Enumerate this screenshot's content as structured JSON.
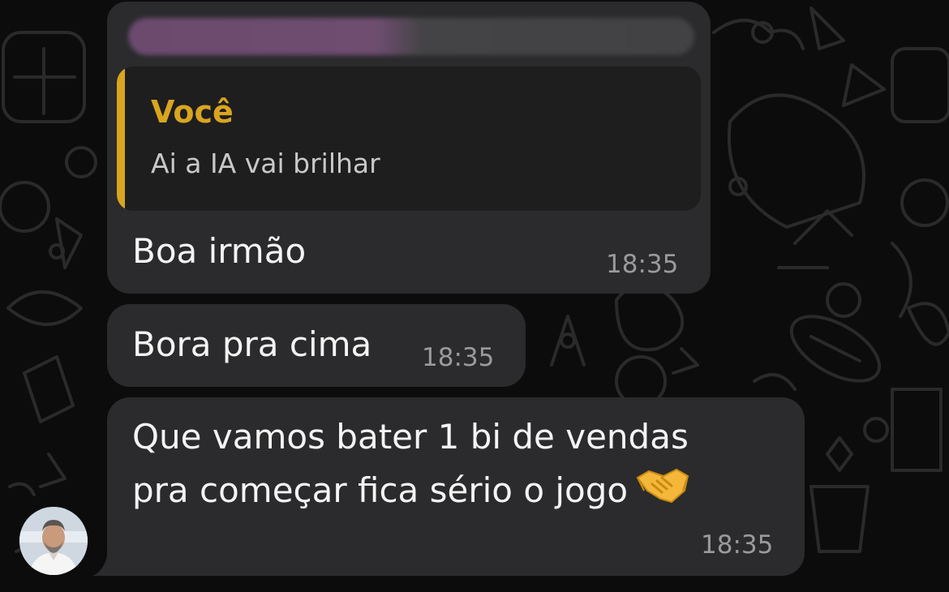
{
  "chat": {
    "messages": [
      {
        "reply_to": {
          "author": "Você",
          "text": "Ai a IA vai brilhar"
        },
        "text": "Boa irmão",
        "time": "18:35"
      },
      {
        "text": "Bora pra cima",
        "time": "18:35"
      },
      {
        "text_line1": "Que vamos bater 1 bi de vendas",
        "text_line2": "pra começar fica sério o jogo",
        "emoji": "handshake-emoji",
        "time": "18:35"
      }
    ]
  },
  "colors": {
    "bubble_bg": "#2b2b2d",
    "quote_accent": "#d9a520",
    "timestamp": "#9a9a9a",
    "chat_bg": "#0c0c0c"
  }
}
